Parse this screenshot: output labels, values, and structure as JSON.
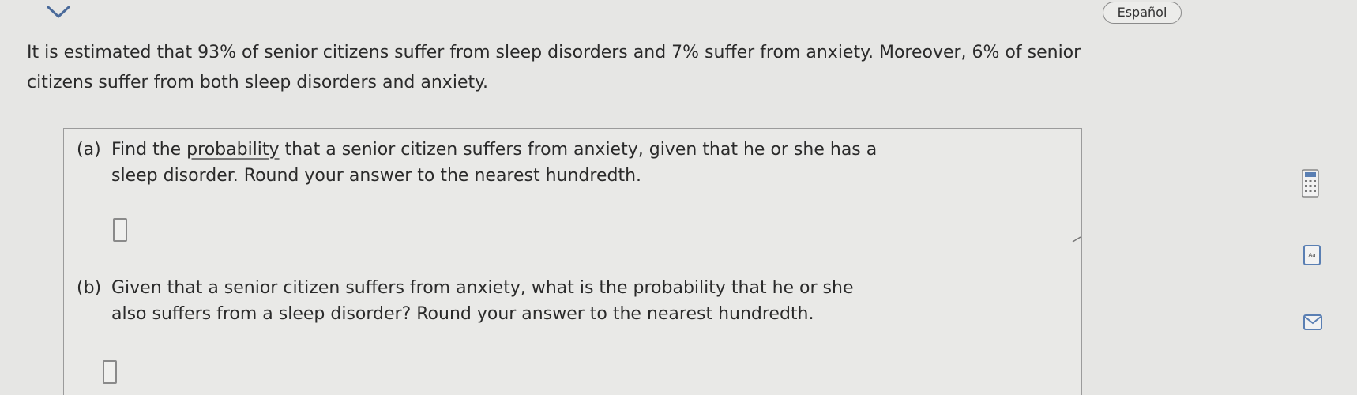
{
  "header": {
    "language_button_label": "Español",
    "chevron_icon": "chevron-down-icon"
  },
  "problem": {
    "intro_line1": "It is estimated that 93% of senior citizens suffer from sleep disorders and 7% suffer from anxiety. Moreover, 6% of senior",
    "intro_line2": "citizens suffer from both sleep disorders and anxiety."
  },
  "part_a": {
    "label": "(a)",
    "text_before_link": "Find the ",
    "link_text": "probability",
    "text_after_link": " that a senior citizen suffers from anxiety, given that he or she has a",
    "line2": "sleep disorder. Round your answer to the nearest hundredth.",
    "answer_value": ""
  },
  "part_b": {
    "label": "(b)",
    "line1": "Given that a senior citizen suffers from anxiety, what is the probability that he or she",
    "line2": "also suffers from a sleep disorder? Round your answer to the nearest hundredth.",
    "answer_value": ""
  },
  "side_tools": {
    "calculator_icon": "calculator-icon",
    "data_icon": "data-icon",
    "mail_icon": "envelope-icon"
  },
  "colors": {
    "background": "#e6e6e4",
    "text": "#2a2a2a",
    "border": "#9b9b9b"
  }
}
